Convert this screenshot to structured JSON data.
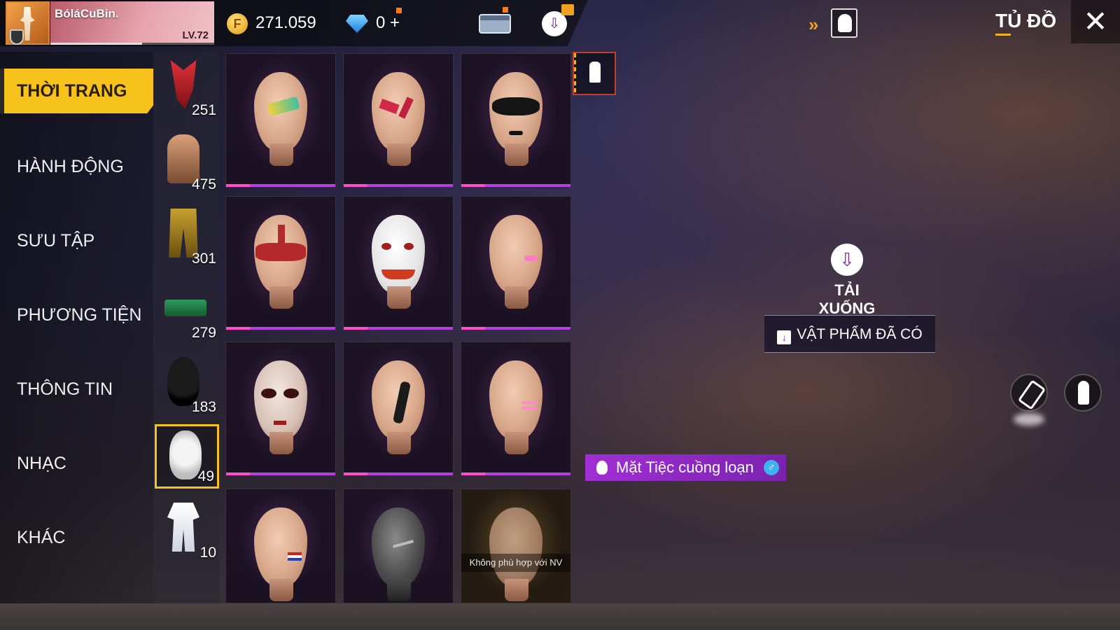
{
  "player": {
    "name": "BóláCuBin.",
    "level": "LV.72",
    "xp_fraction": 0.56
  },
  "currency": {
    "coins": "271.059",
    "diamonds": "0",
    "add_symbol": "+"
  },
  "header": {
    "title": "TỦ ĐỒ",
    "close_symbol": "✕",
    "chevrons": "»",
    "accent_color": "#f7c21c"
  },
  "menu": [
    {
      "label": "THỜI TRANG",
      "active": true
    },
    {
      "label": "HÀNH ĐỘNG",
      "active": false
    },
    {
      "label": "SƯU TẬP",
      "active": false
    },
    {
      "label": "PHƯƠNG TIỆN",
      "active": false
    },
    {
      "label": "THÔNG TIN",
      "active": false
    },
    {
      "label": "NHẠC",
      "active": false
    },
    {
      "label": "KHÁC",
      "active": false
    }
  ],
  "categories": [
    {
      "icon": "mask-icon",
      "count": "251"
    },
    {
      "icon": "top-icon",
      "count": "475"
    },
    {
      "icon": "pants-icon",
      "count": "301"
    },
    {
      "icon": "vehicle-icon",
      "count": "279"
    },
    {
      "icon": "head-icon",
      "count": "183"
    },
    {
      "icon": "face-paint-icon",
      "count": "49",
      "active": true
    },
    {
      "icon": "outfit-icon",
      "count": "10"
    }
  ],
  "grid": {
    "items": [
      {
        "style": "yellow-green-paint"
      },
      {
        "style": "red-eye-paint"
      },
      {
        "style": "black-eye-mask"
      },
      {
        "style": "red-band-mask"
      },
      {
        "style": "joker-white"
      },
      {
        "style": "pink-cheek"
      },
      {
        "style": "dark-eye-blood"
      },
      {
        "style": "tribal-tattoo"
      },
      {
        "style": "pink-stripes"
      },
      {
        "style": "flag-cheek"
      },
      {
        "style": "grey-mannequin"
      },
      {
        "style": "not-suitable"
      }
    ],
    "not_suitable_text": "Không phù hợp với NV"
  },
  "preview": {
    "download_label": "TẢI XUỐNG",
    "owned_button_label": "VẬT PHẨM ĐÃ CÓ",
    "item_name": "Mặt Tiệc cuồng loạn",
    "gender_symbol": "♂"
  }
}
